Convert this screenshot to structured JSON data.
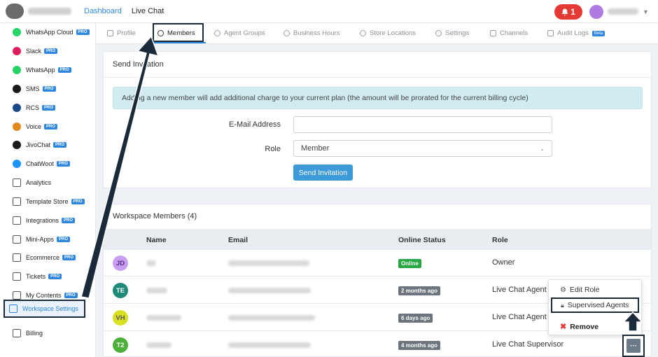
{
  "topbar": {
    "nav": [
      "Dashboard",
      "Live Chat"
    ],
    "notifications": "1"
  },
  "sidebar": {
    "items": [
      {
        "label": "WhatsApp Cloud",
        "pro": "PRO",
        "color": "#25d366"
      },
      {
        "label": "Slack",
        "pro": "PRO",
        "color": "#e01e5a"
      },
      {
        "label": "WhatsApp",
        "pro": "PRO",
        "color": "#25d366"
      },
      {
        "label": "SMS",
        "pro": "PRO",
        "color": "#1a1a1a"
      },
      {
        "label": "RCS",
        "pro": "PRO",
        "color": "#1a4a8a"
      },
      {
        "label": "Voice",
        "pro": "PRO",
        "color": "#e08a1e"
      },
      {
        "label": "JivoChat",
        "pro": "PRO",
        "color": "#1a1a1a"
      },
      {
        "label": "ChatWoot",
        "pro": "PRO",
        "color": "#1f93ff"
      },
      {
        "label": "Analytics",
        "pro": "",
        "color": "#555"
      },
      {
        "label": "Template Store",
        "pro": "PRO",
        "color": "#555"
      },
      {
        "label": "Integrations",
        "pro": "PRO",
        "color": "#555"
      },
      {
        "label": "Mini-Apps",
        "pro": "PRO",
        "color": "#555"
      },
      {
        "label": "Ecommerce",
        "pro": "PRO",
        "color": "#555"
      },
      {
        "label": "Tickets",
        "pro": "PRO",
        "color": "#555"
      },
      {
        "label": "My Contents",
        "pro": "PRO",
        "color": "#555"
      },
      {
        "label": "Workspace Settings",
        "pro": "",
        "color": "#2e86de"
      },
      {
        "label": "Billing",
        "pro": "",
        "color": "#555"
      }
    ]
  },
  "tabs": [
    {
      "label": "Profile"
    },
    {
      "label": "Members"
    },
    {
      "label": "Agent Groups"
    },
    {
      "label": "Business Hours"
    },
    {
      "label": "Store Locations"
    },
    {
      "label": "Settings"
    },
    {
      "label": "Channels"
    },
    {
      "label": "Audit Logs",
      "badge": "Beta"
    }
  ],
  "invite": {
    "title": "Send Invitation",
    "alert": "Adding a new member will add additional charge to your current plan (the amount will be prorated for the current billing cycle)",
    "email_label": "E-Mail Address",
    "email_value": "",
    "role_label": "Role",
    "role_value": "Member",
    "button": "Send Invitation"
  },
  "members": {
    "title": "Workspace Members (4)",
    "columns": [
      "Name",
      "Email",
      "Online Status",
      "Role"
    ],
    "rows": [
      {
        "initials": "JD",
        "status": "Online",
        "status_color": "#28a745",
        "role": "Owner",
        "avatar_bg": "#c89ff0",
        "avatar_fg": "#5a2a8a"
      },
      {
        "initials": "TE",
        "status": "2 months ago",
        "status_color": "#6c757d",
        "role": "Live Chat Agent",
        "avatar_bg": "#1e8a7a",
        "avatar_fg": "#ffffff"
      },
      {
        "initials": "VH",
        "status": "6 days ago",
        "status_color": "#6c757d",
        "role": "Live Chat Agent",
        "avatar_bg": "#d7e021",
        "avatar_fg": "#555555"
      },
      {
        "initials": "T2",
        "status": "4 months ago",
        "status_color": "#6c757d",
        "role": "Live Chat Supervisor",
        "avatar_bg": "#4caf3a",
        "avatar_fg": "#ffffff"
      }
    ]
  },
  "menu": {
    "edit_role": "Edit Role",
    "supervised": "Supervised Agents",
    "remove": "Remove",
    "dots": "···"
  }
}
